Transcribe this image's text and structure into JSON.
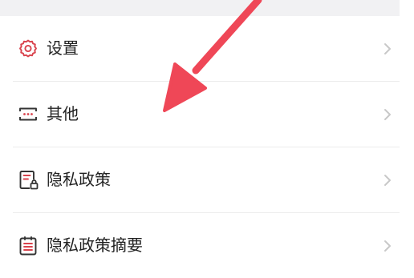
{
  "menu": {
    "items": [
      {
        "label": "设置",
        "icon": "gear-icon",
        "chevron": "chevron-right-icon"
      },
      {
        "label": "其他",
        "icon": "more-icon",
        "chevron": "chevron-right-icon"
      },
      {
        "label": "隐私政策",
        "icon": "document-lock-icon",
        "chevron": "chevron-right-icon"
      },
      {
        "label": "隐私政策摘要",
        "icon": "document-list-icon",
        "chevron": "chevron-right-icon"
      }
    ]
  },
  "colors": {
    "icon": "#d9434d",
    "annotation_arrow": "#ef4757",
    "chevron": "#c8c8c8",
    "divider": "#ececec",
    "top_band": "#f1f1f3",
    "text": "#222222"
  }
}
